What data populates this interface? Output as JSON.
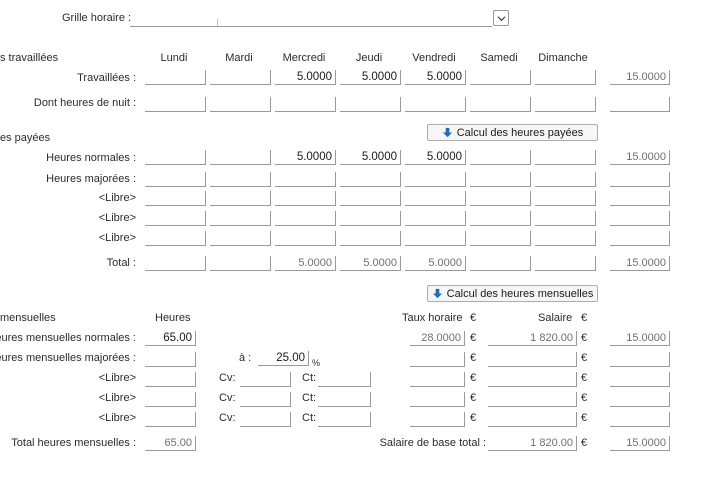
{
  "grille": {
    "label": "Grille horaire :"
  },
  "sections": {
    "travaillees": "s travaillées",
    "payees": "es payées",
    "mensuelles": " mensuelles"
  },
  "days": [
    "Lundi",
    "Mardi",
    "Mercredi",
    "Jeudi",
    "Vendredi",
    "Samedi",
    "Dimanche"
  ],
  "rows": {
    "travaillees": {
      "label": "Travaillées :",
      "values": [
        "",
        "",
        "5.0000",
        "5.0000",
        "5.0000",
        "",
        ""
      ],
      "total": "15.0000"
    },
    "nuit": {
      "label": "Dont heures de nuit :",
      "values": [
        "",
        "",
        "",
        "",
        "",
        "",
        ""
      ],
      "total": ""
    },
    "normales": {
      "label": "Heures normales :",
      "values": [
        "",
        "",
        "5.0000",
        "5.0000",
        "5.0000",
        "",
        ""
      ],
      "total": "15.0000"
    },
    "majorees": {
      "label": "Heures majorées :",
      "values": [
        "",
        "",
        "",
        "",
        "",
        "",
        ""
      ],
      "total": ""
    },
    "libre1": {
      "label": "<Libre>",
      "values": [
        "",
        "",
        "",
        "",
        "",
        "",
        ""
      ],
      "total": ""
    },
    "libre2": {
      "label": "<Libre>",
      "values": [
        "",
        "",
        "",
        "",
        "",
        "",
        ""
      ],
      "total": ""
    },
    "libre3": {
      "label": "<Libre>",
      "values": [
        "",
        "",
        "",
        "",
        "",
        "",
        ""
      ],
      "total": ""
    },
    "total": {
      "label": "Total :",
      "values": [
        "",
        "",
        "5.0000",
        "5.0000",
        "5.0000",
        "",
        ""
      ],
      "total": "15.0000"
    }
  },
  "buttons": {
    "calcul_payees": "Calcul des heures payées",
    "calcul_mensuelles": "Calcul des heures mensuelles"
  },
  "mensuelles": {
    "col_heures": "Heures",
    "col_taux": "Taux horaire",
    "col_salaire": "Salaire",
    "currency": "€",
    "normales": {
      "label": "Heures mensuelles normales :",
      "heures": "65.00",
      "taux": "28.0000",
      "salaire": "1 820.00",
      "total": "15.0000"
    },
    "majorees": {
      "label": "Heures mensuelles majorées :",
      "heures": "",
      "a_label": "à :",
      "a_value": "25.00",
      "percent": "%"
    },
    "libre1": {
      "label": "<Libre>",
      "cv": "Cv:",
      "ct": "Ct:"
    },
    "libre2": {
      "label": "<Libre>",
      "cv": "Cv:",
      "ct": "Ct:"
    },
    "libre3": {
      "label": "<Libre>",
      "cv": "Cv:",
      "ct": "Ct:"
    },
    "total": {
      "label": "Total heures mensuelles :",
      "heures": "65.00",
      "salaire_label": "Salaire de base total :",
      "salaire": "1 820.00",
      "total": "15.0000"
    }
  }
}
